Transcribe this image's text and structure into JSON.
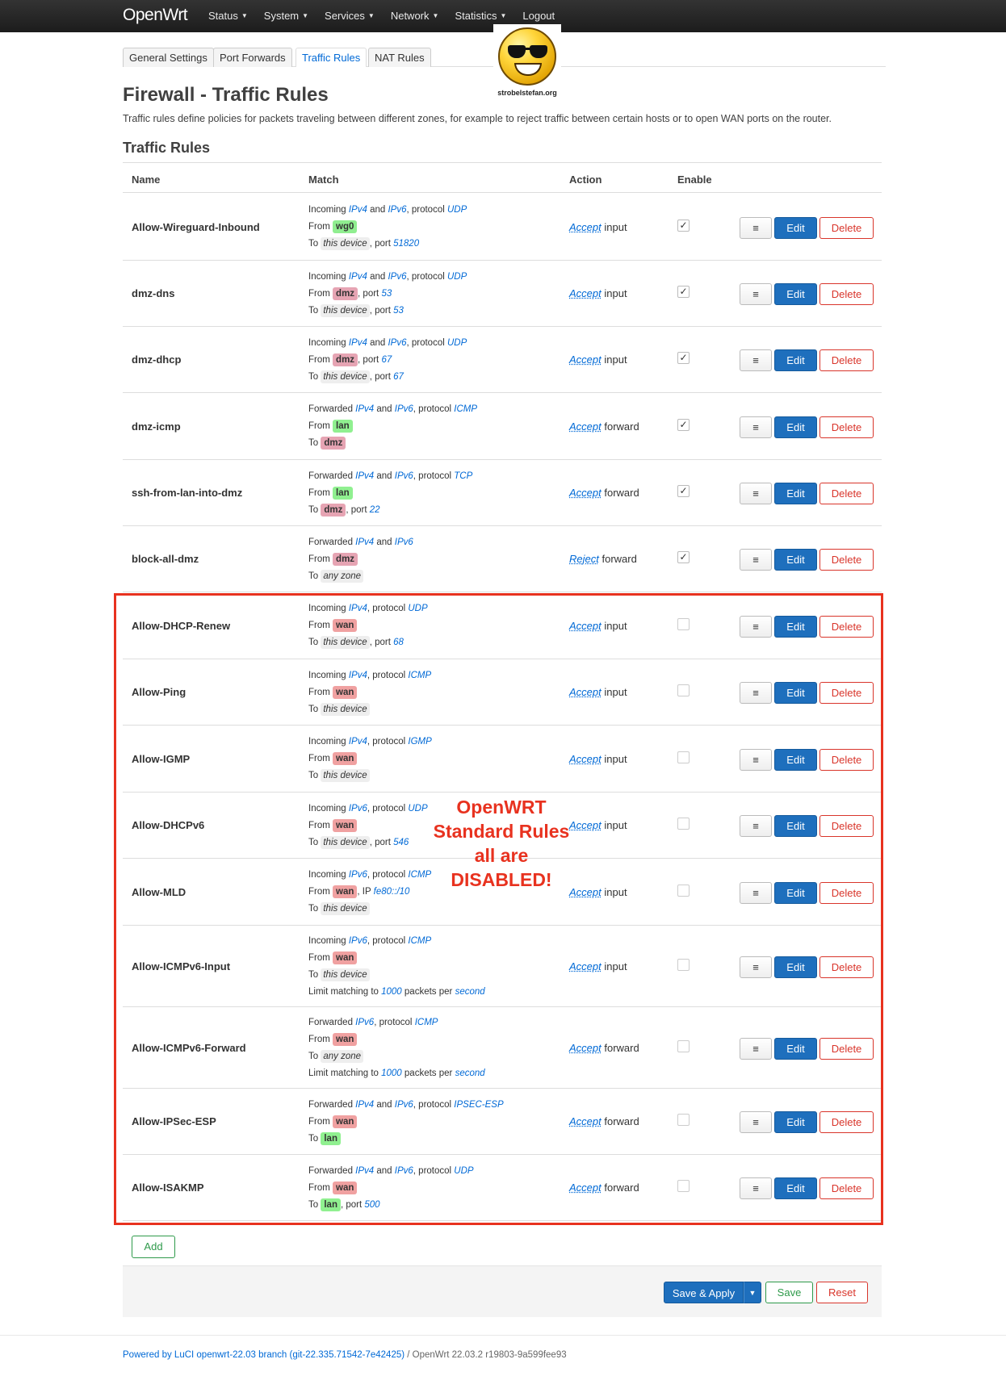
{
  "nav": {
    "brand": "OpenWrt",
    "menu": [
      "Status",
      "System",
      "Services",
      "Network",
      "Statistics"
    ],
    "logout": "Logout"
  },
  "tabs": [
    "General Settings",
    "Port Forwards",
    "Traffic Rules",
    "NAT Rules"
  ],
  "active_tab": "Traffic Rules",
  "logo_text": "strobelstefan.org",
  "page": {
    "title": "Firewall - Traffic Rules",
    "description": "Traffic rules define policies for packets traveling between different zones, for example to reject traffic between certain hosts or to open WAN ports on the router.",
    "section_title": "Traffic Rules"
  },
  "table": {
    "headers": {
      "name": "Name",
      "match": "Match",
      "action": "Action",
      "enable": "Enable"
    },
    "buttons": {
      "drag": "≡",
      "edit": "Edit",
      "delete": "Delete"
    },
    "rows": [
      {
        "name": "Allow-Wireguard-Inbound",
        "enabled": true,
        "l1": [
          "Incoming ",
          "IPv4",
          " and ",
          "IPv6",
          ", protocol ",
          "UDP"
        ],
        "from": "wg0",
        "from_extra": "",
        "to": "this device",
        "to_extra": ", port ",
        "to_port": "51820",
        "limit": null,
        "action_verb": "Accept",
        "action_target": "input"
      },
      {
        "name": "dmz-dns",
        "enabled": true,
        "l1": [
          "Incoming ",
          "IPv4",
          " and ",
          "IPv6",
          ", protocol ",
          "UDP"
        ],
        "from": "dmz",
        "from_extra": ", port ",
        "from_port": "53",
        "to": "this device",
        "to_extra": ", port ",
        "to_port": "53",
        "limit": null,
        "action_verb": "Accept",
        "action_target": "input"
      },
      {
        "name": "dmz-dhcp",
        "enabled": true,
        "l1": [
          "Incoming ",
          "IPv4",
          " and ",
          "IPv6",
          ", protocol ",
          "UDP"
        ],
        "from": "dmz",
        "from_extra": ", port ",
        "from_port": "67",
        "to": "this device",
        "to_extra": ", port ",
        "to_port": "67",
        "limit": null,
        "action_verb": "Accept",
        "action_target": "input"
      },
      {
        "name": "dmz-icmp",
        "enabled": true,
        "l1": [
          "Forwarded ",
          "IPv4",
          " and ",
          "IPv6",
          ", protocol ",
          "ICMP"
        ],
        "from": "lan",
        "from_extra": "",
        "to": "dmz",
        "to_extra": "",
        "to_port": "",
        "limit": null,
        "action_verb": "Accept",
        "action_target": "forward"
      },
      {
        "name": "ssh-from-lan-into-dmz",
        "enabled": true,
        "l1": [
          "Forwarded ",
          "IPv4",
          " and ",
          "IPv6",
          ", protocol ",
          "TCP"
        ],
        "from": "lan",
        "from_extra": "",
        "to": "dmz",
        "to_extra": ", port ",
        "to_port": "22",
        "limit": null,
        "action_verb": "Accept",
        "action_target": "forward"
      },
      {
        "name": "block-all-dmz",
        "enabled": true,
        "l1": [
          "Forwarded ",
          "IPv4",
          " and ",
          "IPv6",
          "",
          ""
        ],
        "from": "dmz",
        "from_extra": "",
        "to": "any zone",
        "to_extra": "",
        "to_port": "",
        "limit": null,
        "action_verb": "Reject",
        "action_target": "forward"
      },
      {
        "name": "Allow-DHCP-Renew",
        "enabled": false,
        "l1": [
          "Incoming ",
          "IPv4",
          ", protocol ",
          "UDP",
          "",
          ""
        ],
        "from": "wan",
        "from_extra": "",
        "to": "this device",
        "to_extra": ", port ",
        "to_port": "68",
        "limit": null,
        "action_verb": "Accept",
        "action_target": "input"
      },
      {
        "name": "Allow-Ping",
        "enabled": false,
        "l1": [
          "Incoming ",
          "IPv4",
          ", protocol ",
          "ICMP",
          "",
          ""
        ],
        "from": "wan",
        "from_extra": "",
        "to": "this device",
        "to_extra": "",
        "to_port": "",
        "limit": null,
        "action_verb": "Accept",
        "action_target": "input"
      },
      {
        "name": "Allow-IGMP",
        "enabled": false,
        "l1": [
          "Incoming ",
          "IPv4",
          ", protocol ",
          "IGMP",
          "",
          ""
        ],
        "from": "wan",
        "from_extra": "",
        "to": "this device",
        "to_extra": "",
        "to_port": "",
        "limit": null,
        "action_verb": "Accept",
        "action_target": "input"
      },
      {
        "name": "Allow-DHCPv6",
        "enabled": false,
        "l1": [
          "Incoming ",
          "IPv6",
          ", protocol ",
          "UDP",
          "",
          ""
        ],
        "from": "wan",
        "from_extra": "",
        "to": "this device",
        "to_extra": ", port ",
        "to_port": "546",
        "limit": null,
        "action_verb": "Accept",
        "action_target": "input"
      },
      {
        "name": "Allow-MLD",
        "enabled": false,
        "l1": [
          "Incoming ",
          "IPv6",
          ", protocol ",
          "ICMP",
          "",
          ""
        ],
        "from": "wan",
        "from_extra": ", IP ",
        "from_port": "fe80::/10",
        "to": "this device",
        "to_extra": "",
        "to_port": "",
        "limit": null,
        "action_verb": "Accept",
        "action_target": "input"
      },
      {
        "name": "Allow-ICMPv6-Input",
        "enabled": false,
        "l1": [
          "Incoming ",
          "IPv6",
          ", protocol ",
          "ICMP",
          "",
          ""
        ],
        "from": "wan",
        "from_extra": "",
        "to": "this device",
        "to_extra": "",
        "to_port": "",
        "limit": [
          "Limit matching to ",
          "1000",
          " packets per ",
          "second"
        ],
        "action_verb": "Accept",
        "action_target": "input"
      },
      {
        "name": "Allow-ICMPv6-Forward",
        "enabled": false,
        "l1": [
          "Forwarded ",
          "IPv6",
          ", protocol ",
          "ICMP",
          "",
          ""
        ],
        "from": "wan",
        "from_extra": "",
        "to": "any zone",
        "to_extra": "",
        "to_port": "",
        "limit": [
          "Limit matching to ",
          "1000",
          " packets per ",
          "second"
        ],
        "action_verb": "Accept",
        "action_target": "forward"
      },
      {
        "name": "Allow-IPSec-ESP",
        "enabled": false,
        "l1": [
          "Forwarded ",
          "IPv4",
          " and ",
          "IPv6",
          ", protocol ",
          "IPSEC-ESP"
        ],
        "from": "wan",
        "from_extra": "",
        "to": "lan",
        "to_extra": "",
        "to_port": "",
        "limit": null,
        "action_verb": "Accept",
        "action_target": "forward"
      },
      {
        "name": "Allow-ISAKMP",
        "enabled": false,
        "l1": [
          "Forwarded ",
          "IPv4",
          " and ",
          "IPv6",
          ", protocol ",
          "UDP"
        ],
        "from": "wan",
        "from_extra": "",
        "to": "lan",
        "to_extra": ", port ",
        "to_port": "500",
        "limit": null,
        "action_verb": "Accept",
        "action_target": "forward"
      }
    ]
  },
  "labels": {
    "from": "From",
    "to": "To"
  },
  "zone_colors": {
    "wg0": "#90ee90",
    "dmz": "#e6a4b3",
    "lan": "#90f090",
    "wan": "#f0a1a1"
  },
  "annotation": [
    "OpenWRT",
    "Standard Rules",
    "all are",
    "DISABLED!"
  ],
  "add_button": "Add",
  "footer_actions": {
    "save_apply": "Save & Apply",
    "save": "Save",
    "reset": "Reset"
  },
  "page_footer": {
    "link": "Powered by LuCI openwrt-22.03 branch (git-22.335.71542-7e42425)",
    "rest": " / OpenWrt 22.03.2 r19803-9a599fee93"
  }
}
